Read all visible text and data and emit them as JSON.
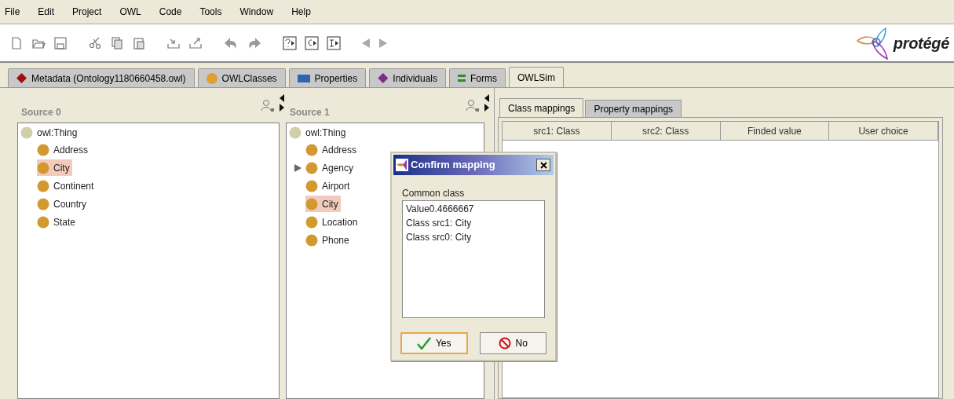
{
  "menu": [
    "File",
    "Edit",
    "Project",
    "OWL",
    "Code",
    "Tools",
    "Window",
    "Help"
  ],
  "logo": {
    "text": "protégé"
  },
  "tabs": [
    {
      "label": "Metadata (Ontology1180660458.owl)",
      "kind": "diamond",
      "color": "#9b1010",
      "selected": false
    },
    {
      "label": "OWLClasses",
      "kind": "circle",
      "color": "#e0a030",
      "selected": false
    },
    {
      "label": "Properties",
      "kind": "rect",
      "color": "#2e64b0",
      "selected": false
    },
    {
      "label": "Individuals",
      "kind": "diamond",
      "color": "#7a2e86",
      "selected": false
    },
    {
      "label": "Forms",
      "kind": "bars",
      "color": "#2e8a2e",
      "selected": false
    },
    {
      "label": "OWLSim",
      "kind": "none",
      "selected": true
    }
  ],
  "sources": [
    {
      "title": "Source 0",
      "root": {
        "label": "owl:Thing",
        "children": [
          {
            "label": "Address",
            "selected": false,
            "expandable": false
          },
          {
            "label": "City",
            "selected": true,
            "expandable": false
          },
          {
            "label": "Continent",
            "selected": false,
            "expandable": false
          },
          {
            "label": "Country",
            "selected": false,
            "expandable": false
          },
          {
            "label": "State",
            "selected": false,
            "expandable": false
          }
        ]
      }
    },
    {
      "title": "Source 1",
      "root": {
        "label": "owl:Thing",
        "children": [
          {
            "label": "Address",
            "selected": false,
            "expandable": false
          },
          {
            "label": "Agency",
            "selected": false,
            "expandable": true
          },
          {
            "label": "Airport",
            "selected": false,
            "expandable": false
          },
          {
            "label": "City",
            "selected": true,
            "expandable": false
          },
          {
            "label": "Location",
            "selected": false,
            "expandable": false
          },
          {
            "label": "Phone",
            "selected": false,
            "expandable": false
          }
        ]
      }
    }
  ],
  "mapping_tabs": [
    {
      "label": "Class mappings",
      "selected": true
    },
    {
      "label": "Property mappings",
      "selected": false
    }
  ],
  "table": {
    "columns": [
      "src1: Class",
      "src2: Class",
      "Finded value",
      "User choice"
    ]
  },
  "dialog": {
    "title": "Confirm mapping",
    "list_label": "Common class",
    "list_items": [
      "Value0.4666667",
      "Class src1: City",
      "Class src0: City"
    ],
    "buttons": [
      {
        "label": "Yes",
        "kind": "yes",
        "focused": true
      },
      {
        "label": "No",
        "kind": "no",
        "focused": false
      }
    ]
  }
}
